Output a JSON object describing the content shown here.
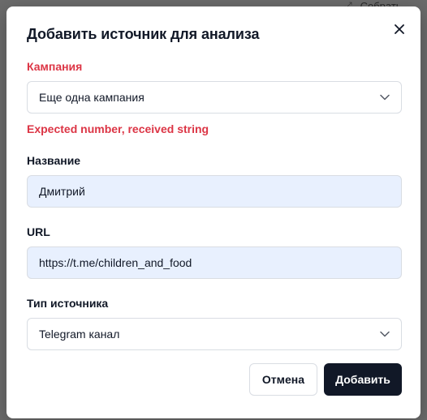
{
  "background": {
    "text": "Собрать"
  },
  "dialog": {
    "title": "Добавить источник для анализа",
    "close_icon": "close-icon",
    "campaign": {
      "label": "Кампания",
      "value": "Еще одна кампания",
      "error": "Expected number, received string"
    },
    "name": {
      "label": "Название",
      "value": "Дмитрий"
    },
    "url": {
      "label": "URL",
      "value": "https://t.me/children_and_food"
    },
    "source_type": {
      "label": "Тип источника",
      "value": "Telegram канал"
    },
    "buttons": {
      "cancel": "Отмена",
      "submit": "Добавить"
    }
  },
  "colors": {
    "overlay": "#6b6b6b",
    "error": "#dc3545",
    "primary_button": "#111827",
    "autofill_input": "#e8f0fe"
  }
}
